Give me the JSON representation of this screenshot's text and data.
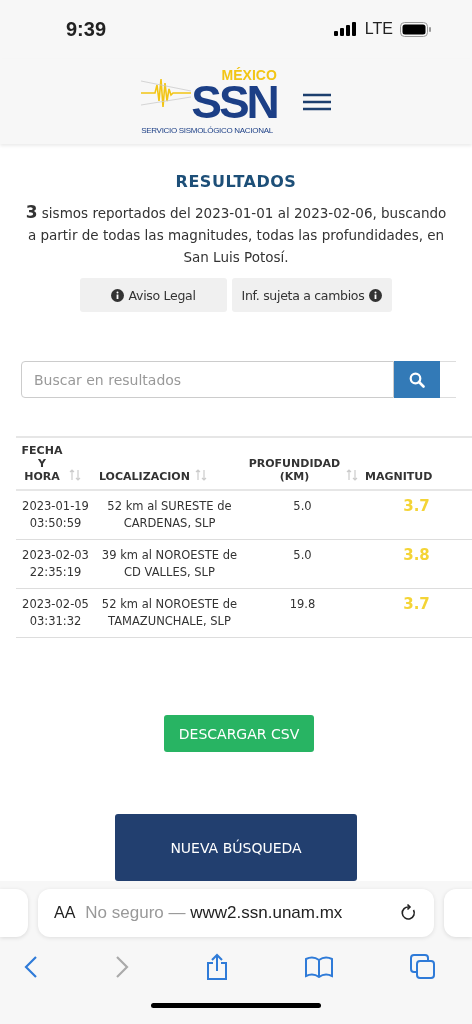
{
  "status_bar": {
    "time": "9:39",
    "network": "LTE"
  },
  "header": {
    "logo": {
      "country": "MÉXICO",
      "acronym": "SSN",
      "subtitle": "SERVICIO SISMOLÓGICO NACIONAL"
    }
  },
  "title": "RESULTADOS",
  "summary": "**3** sismos reportados del 2023-01-01 al 2023-02-06, buscando a partir de todas las magnitudes, todas las profundidades, en San Luis Potosí.",
  "info_buttons": [
    {
      "label": "Aviso Legal",
      "icon_first": true
    },
    {
      "label": "Inf. sujeta a cambios",
      "icon_first": false
    }
  ],
  "search": {
    "placeholder": "Buscar en resultados"
  },
  "table": {
    "columns": [
      {
        "label": "FECHA Y HORA",
        "sortable": true
      },
      {
        "label": "LOCALIZACION",
        "sortable": true
      },
      {
        "label": "PROFUNDIDAD (KM)",
        "sortable": true
      },
      {
        "label": "MAGNITUD",
        "sortable": false
      }
    ],
    "rows": [
      {
        "date": "2023-01-19",
        "time": "03:50:59",
        "location": "52 km al SURESTE de CARDENAS, SLP",
        "depth": "5.0",
        "magnitude": "3.7"
      },
      {
        "date": "2023-02-03",
        "time": "22:35:19",
        "location": "39 km al NOROESTE de CD VALLES, SLP",
        "depth": "5.0",
        "magnitude": "3.8"
      },
      {
        "date": "2023-02-05",
        "time": "03:31:32",
        "location": "52 km al NOROESTE de TAMAZUNCHALE, SLP",
        "depth": "19.8",
        "magnitude": "3.7"
      }
    ]
  },
  "download_button": "DESCARGAR CSV",
  "new_search_button": "NUEVA BÚSQUEDA",
  "browser": {
    "text_size": "AA",
    "security": "No seguro —",
    "domain": "www2.ssn.unam.mx",
    "forward_disabled": true
  }
}
